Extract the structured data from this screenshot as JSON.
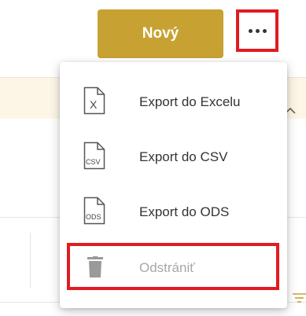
{
  "toolbar": {
    "new_button_label": "Nový",
    "more_button": {
      "icon": "more-horizontal-icon"
    },
    "accent_color": "#c7a132",
    "highlight_color": "#e11b22"
  },
  "menu": {
    "items": [
      {
        "label": "Export do Excelu",
        "icon": "excel-file-icon",
        "file_tag": "X",
        "disabled": false
      },
      {
        "label": "Export do CSV",
        "icon": "csv-file-icon",
        "file_tag": "CSV",
        "disabled": false
      },
      {
        "label": "Export do ODS",
        "icon": "ods-file-icon",
        "file_tag": "ODS",
        "disabled": false
      },
      {
        "label": "Odstrániť",
        "icon": "trash-icon",
        "disabled": true
      }
    ]
  }
}
